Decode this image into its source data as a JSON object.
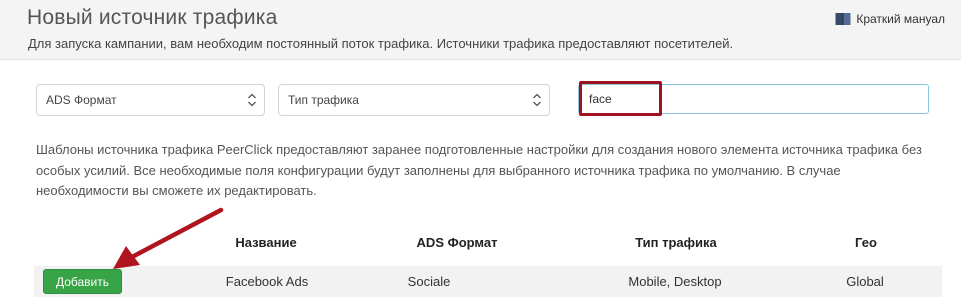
{
  "header": {
    "title": "Новый источник трафика",
    "subtitle": "Для запуска кампании, вам необходим постоянный поток трафика. Источники трафика предоставляют посетителей.",
    "manual_link": "Краткий мануал",
    "manual_icon": "book-icon"
  },
  "filters": {
    "ads_format": {
      "selected": "ADS Формат"
    },
    "traffic_type": {
      "selected": "Тип трафика"
    },
    "search": {
      "value": "face"
    }
  },
  "description": "Шаблоны источника трафика PeerClick предоставляют заранее подготовленные настройки для создания нового элемента источника трафика без особых усилий. Все необходимые поля конфигурации будут заполнены для выбранного источника трафика по умолчанию. В случае необходимости вы сможете их редактировать.",
  "table": {
    "columns": [
      "Название",
      "ADS Формат",
      "Тип трафика",
      "Гео"
    ],
    "rows": [
      {
        "action": "Добавить",
        "name": "Facebook Ads",
        "ads_format": "Sociale",
        "traffic_type": "Mobile, Desktop",
        "geo": "Global"
      }
    ]
  },
  "colors": {
    "add_button": "#38a448",
    "highlight": "#a0121f",
    "arrow": "#b0141f"
  }
}
